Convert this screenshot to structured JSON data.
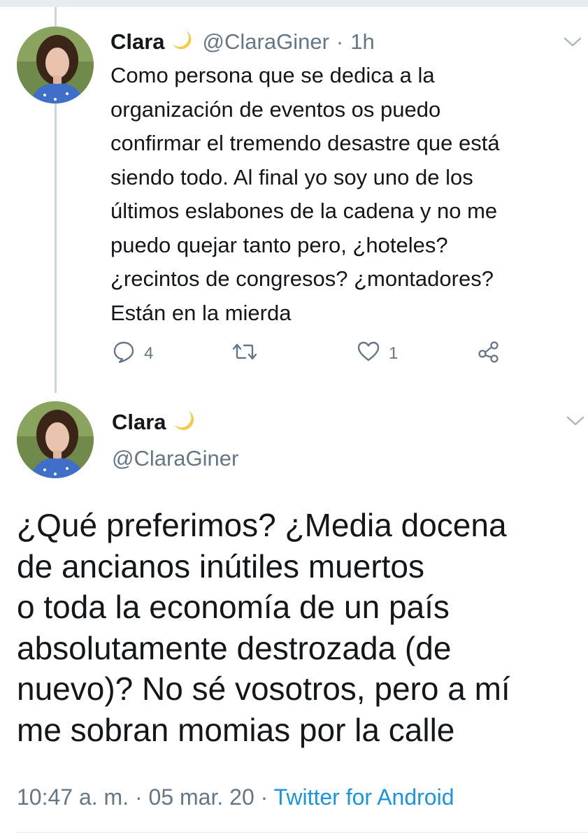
{
  "reply_tweet": {
    "author_name": "Clara",
    "handle": "@ClaraGiner",
    "separator": "·",
    "time_ago": "1h",
    "text_lines": [
      "Como persona que se dedica a la",
      "organización de eventos os puedo",
      "confirmar el tremendo desastre que está",
      "siendo todo. Al final yo soy uno de los",
      "últimos eslabones de la cadena y no me",
      "puedo quejar tanto pero, ¿hoteles?",
      "¿recintos de congresos? ¿montadores?",
      "Están en la mierda"
    ],
    "reply_count": "4",
    "like_count": "1",
    "icons": [
      "reply-icon",
      "retweet-icon",
      "like-icon",
      "share-icon",
      "chevron-down-icon",
      "crescent-moon-emoji"
    ]
  },
  "main_tweet": {
    "author_name": "Clara",
    "handle": "@ClaraGiner",
    "text_lines": [
      "¿Qué preferimos? ¿Media docena",
      "de ancianos inútiles muertos",
      "o toda la economía de un país",
      "absolutamente destrozada (de",
      "nuevo)? No sé vosotros, pero a mí",
      "me sobran momias por la calle"
    ],
    "time": "10:47 a. m.",
    "separator": "·",
    "date": "05 mar. 20",
    "source": "Twitter for Android"
  },
  "colors": {
    "text": "#14171a",
    "secondary": "#657786",
    "link": "#1b95e0",
    "divider": "#e6ecf0",
    "thread_line": "#ccd6dd"
  }
}
